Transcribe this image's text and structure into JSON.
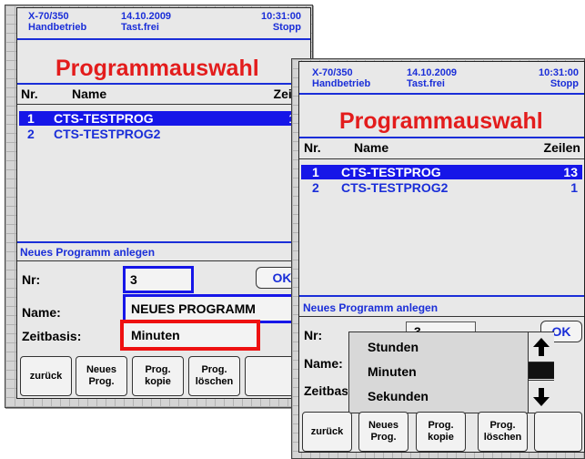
{
  "header": {
    "device": "X-70/350",
    "mode": "Handbetrieb",
    "date": "14.10.2009",
    "keyboard": "Tast.frei",
    "time": "10:31:00",
    "state": "Stopp"
  },
  "title": "Programmauswahl",
  "columns": {
    "nr": "Nr.",
    "name": "Name",
    "zeilen": "Zeilen"
  },
  "programs": [
    {
      "nr": "1",
      "name": "CTS-TESTPROG",
      "zeilen": "13",
      "selected": true
    },
    {
      "nr": "2",
      "name": "CTS-TESTPROG2",
      "zeilen": "1",
      "selected": false
    }
  ],
  "new_program": {
    "section_label": "Neues Programm anlegen",
    "nr_label": "Nr:",
    "nr_value": "3",
    "ok_label": "OK",
    "name_label": "Name:",
    "name_value": "NEUES PROGRAMM",
    "zeitbasis_label": "Zeitbasis:",
    "zeitbasis_value": "Minuten"
  },
  "zeitbasis_options": [
    "Stunden",
    "Minuten",
    "Sekunden"
  ],
  "buttons": {
    "back": "zurück",
    "new_line1": "Neues",
    "new_line2": "Prog.",
    "copy_line1": "Prog.",
    "copy_line2": "kopie",
    "delete_line1": "Prog.",
    "delete_line2": "löschen"
  },
  "colors": {
    "accent_blue": "#1a2ed8",
    "selection_blue": "#1616e8",
    "title_red": "#e31c1c",
    "focus_red": "#ee1111"
  },
  "icons": {
    "scroll_up": "arrow-up-icon",
    "scroll_down": "arrow-down-icon"
  }
}
